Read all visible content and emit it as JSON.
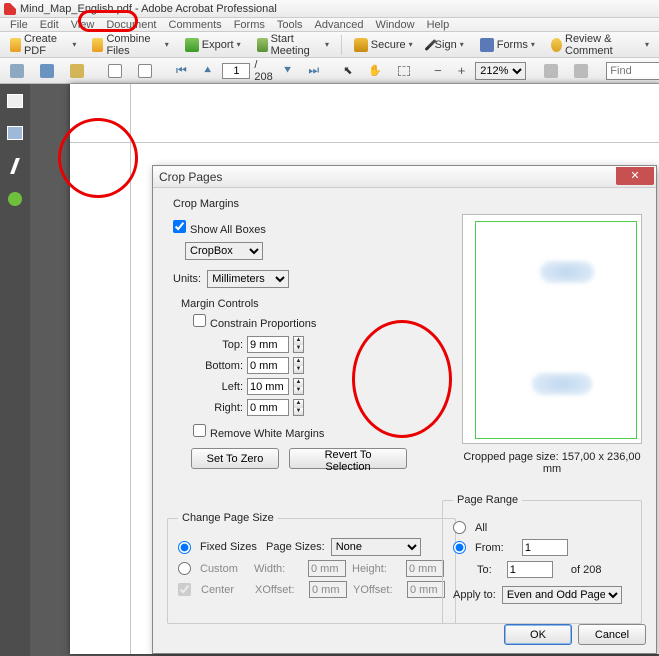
{
  "title": "Mind_Map_English.pdf - Adobe Acrobat Professional",
  "menu": [
    "File",
    "Edit",
    "View",
    "Document",
    "Comments",
    "Forms",
    "Tools",
    "Advanced",
    "Window",
    "Help"
  ],
  "toolbar1": {
    "create": "Create PDF",
    "combine": "Combine Files",
    "export": "Export",
    "meeting": "Start Meeting",
    "secure": "Secure",
    "sign": "Sign",
    "forms": "Forms",
    "review": "Review & Comment"
  },
  "toolbar2": {
    "page_current": "1",
    "page_total": "/ 208",
    "zoom": "212%",
    "find_placeholder": "Find"
  },
  "dialog": {
    "title": "Crop Pages",
    "close": "✕",
    "crop_margins": "Crop Margins",
    "show_all": "Show All Boxes",
    "cropbox": "CropBox",
    "units_label": "Units:",
    "units_value": "Millimeters",
    "margin_controls": "Margin Controls",
    "constrain": "Constrain Proportions",
    "top_label": "Top:",
    "top_value": "9 mm",
    "bottom_label": "Bottom:",
    "bottom_value": "0 mm",
    "left_label": "Left:",
    "left_value": "10 mm",
    "right_label": "Right:",
    "right_value": "0 mm",
    "remove_white": "Remove White Margins",
    "set_zero": "Set To Zero",
    "revert": "Revert To Selection",
    "preview_caption": "Cropped page size: 157,00 x 236,00 mm",
    "change_size": "Change Page Size",
    "fixed": "Fixed Sizes",
    "page_sizes_label": "Page Sizes:",
    "page_sizes_value": "None",
    "custom": "Custom",
    "width_label": "Width:",
    "width_value": "0 mm",
    "height_label": "Height:",
    "height_value": "0 mm",
    "center": "Center",
    "xoffset_label": "XOffset:",
    "xoffset_value": "0 mm",
    "yoffset_label": "YOffset:",
    "yoffset_value": "0 mm",
    "page_range": "Page Range",
    "all": "All",
    "from_label": "From:",
    "from_value": "1",
    "to_label": "To:",
    "to_value": "1",
    "of_label": "of 208",
    "apply_to_label": "Apply to:",
    "apply_to_value": "Even and Odd Pages",
    "ok": "OK",
    "cancel": "Cancel"
  }
}
